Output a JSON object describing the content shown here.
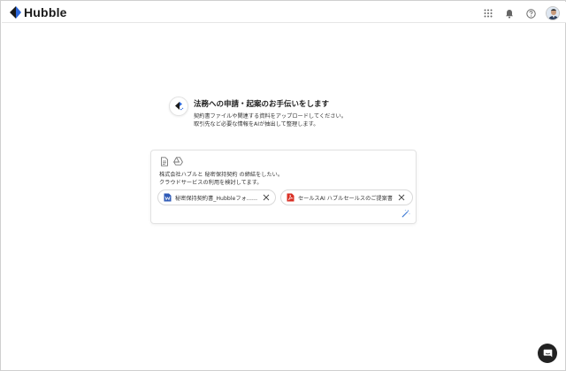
{
  "app": {
    "brand": "Hubble",
    "colors": {
      "brand_dark": "#1a1a1a",
      "accent_blue": "#1f5fd6",
      "pdf_red": "#d93025",
      "doc_blue": "#2f5bb7"
    }
  },
  "header": {
    "icons": [
      "apps-grid-icon",
      "bell-icon",
      "help-icon",
      "avatar"
    ]
  },
  "intro": {
    "title": "法務への申請・起案のお手伝いをします",
    "desc_line1": "契約書ファイルや関連する資料をアップロードしてください。",
    "desc_line2": "取引先など必要な情報をAIが抽出して整理します。"
  },
  "composer": {
    "message_line1": "株式会社ハブルと 秘密保持契約 の締結をしたい。",
    "message_line2": "クラウドサービスの利用を検討してます。",
    "attachments": [
      {
        "label": "秘密保持契約書_Hubbleフォ……",
        "type": "word",
        "icon": "word-file-icon"
      },
      {
        "label": "セールスAI ハブルセールスのご提案書",
        "type": "pdf",
        "icon": "pdf-file-icon"
      }
    ]
  }
}
